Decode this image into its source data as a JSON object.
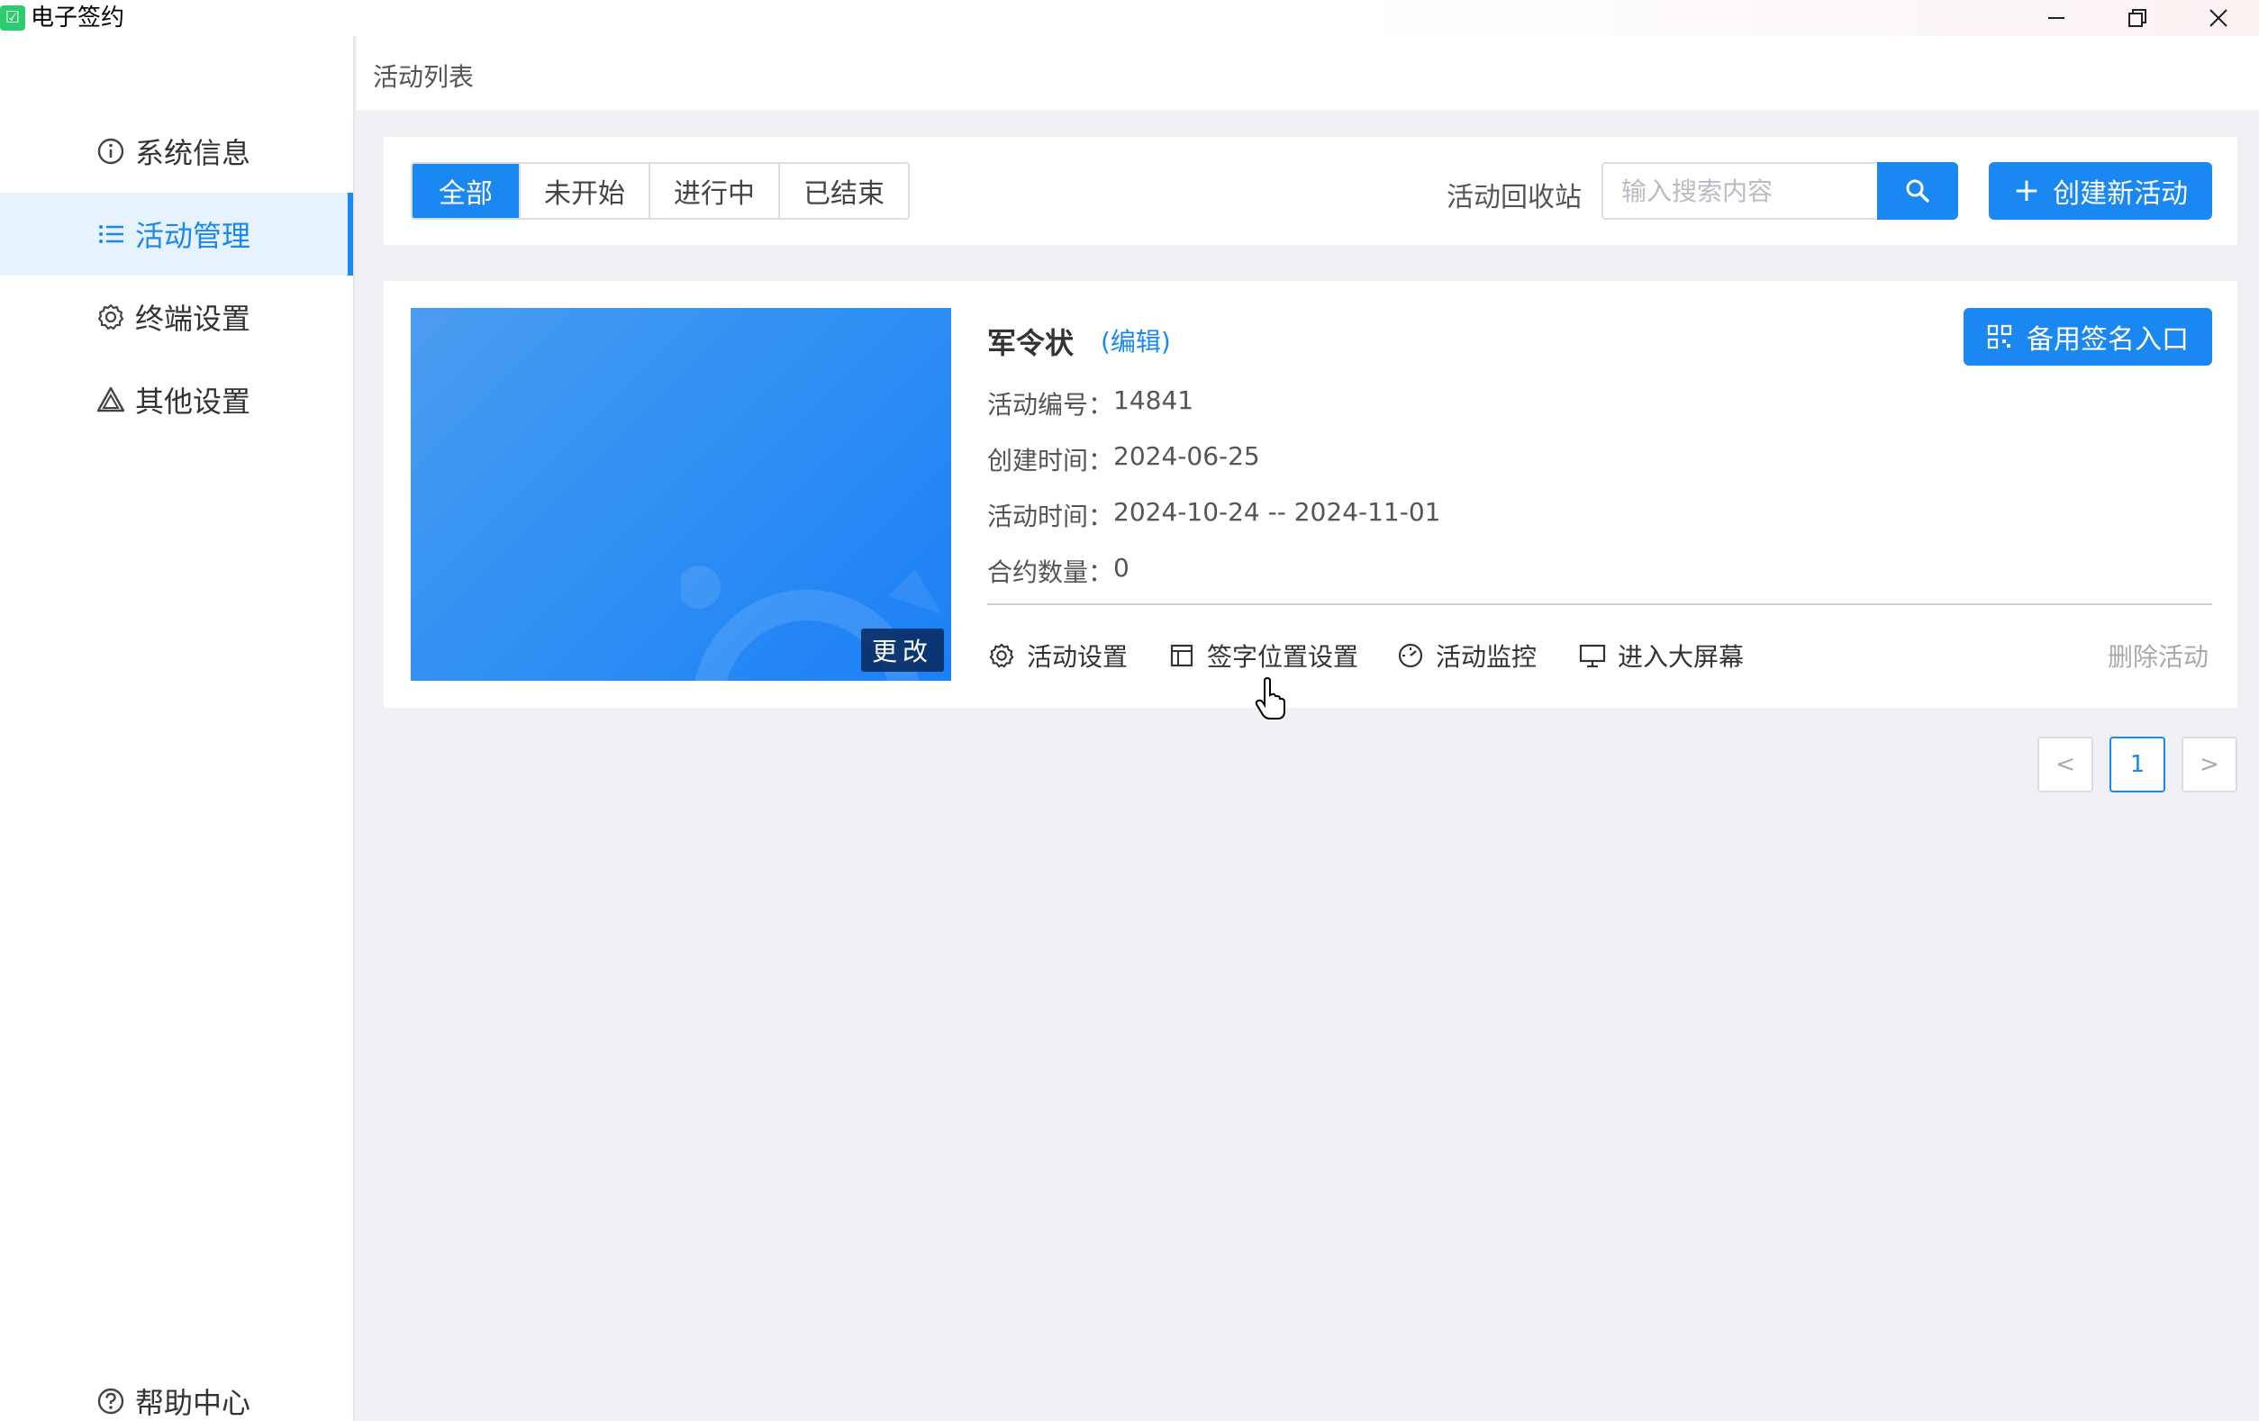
{
  "window": {
    "title": "电子签约",
    "logo_glyph": "☑"
  },
  "sidebar": {
    "items": [
      {
        "label": "系统信息",
        "icon": "info-icon",
        "active": false
      },
      {
        "label": "活动管理",
        "icon": "list-icon",
        "active": true
      },
      {
        "label": "终端设置",
        "icon": "gear-icon",
        "active": false
      },
      {
        "label": "其他设置",
        "icon": "warning-triangle-icon",
        "active": false
      }
    ],
    "help": {
      "label": "帮助中心",
      "icon": "question-icon"
    }
  },
  "header": {
    "title": "活动列表"
  },
  "filters": {
    "tabs": [
      {
        "label": "全部",
        "active": true
      },
      {
        "label": "未开始",
        "active": false
      },
      {
        "label": "进行中",
        "active": false
      },
      {
        "label": "已结束",
        "active": false
      }
    ],
    "recycle_label": "活动回收站",
    "search_placeholder": "输入搜索内容",
    "create_label": "创建新活动"
  },
  "activity": {
    "title": "军令状",
    "edit_label": "(编辑)",
    "change_label": "更改",
    "backup_label": "备用签名入口",
    "fields": [
      {
        "label": "活动编号：",
        "value": "14841"
      },
      {
        "label": "创建时间：",
        "value": "2024-06-25"
      },
      {
        "label": "活动时间：",
        "value": "2024-10-24 -- 2024-11-01"
      },
      {
        "label": "合约数量：",
        "value": "0"
      }
    ],
    "actions": [
      {
        "label": "活动设置",
        "icon": "gear-icon"
      },
      {
        "label": "签字位置设置",
        "icon": "layout-icon"
      },
      {
        "label": "活动监控",
        "icon": "gauge-icon"
      },
      {
        "label": "进入大屏幕",
        "icon": "monitor-icon"
      }
    ],
    "delete_label": "删除活动"
  },
  "pagination": {
    "current": "1",
    "prev": "<",
    "next": ">"
  },
  "colors": {
    "accent": "#1a88f0",
    "active_bg": "#e6f2fd",
    "page_bg": "#f0f1f5"
  }
}
